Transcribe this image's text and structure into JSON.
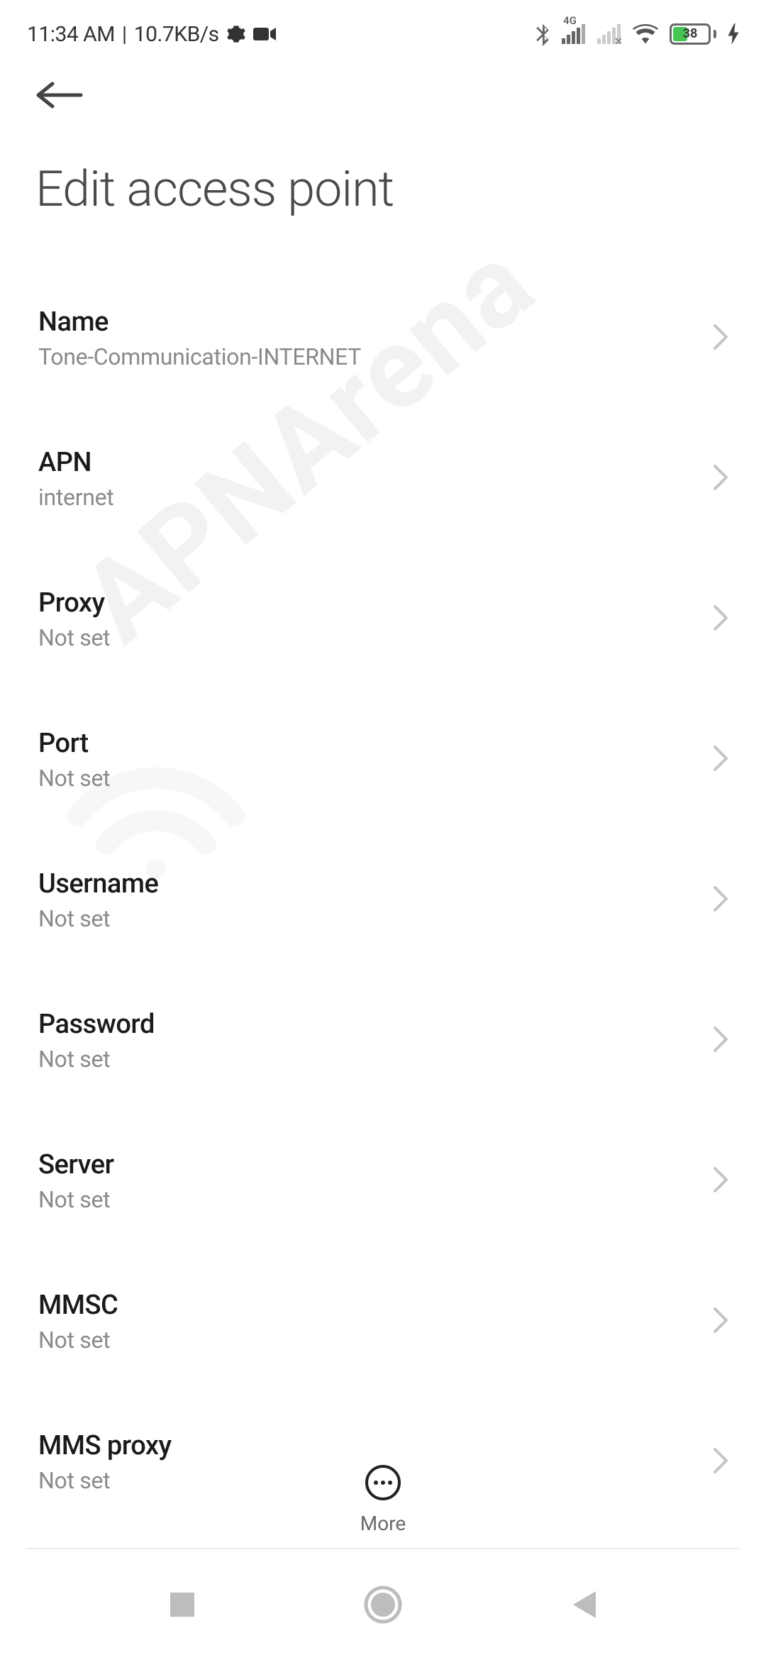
{
  "status": {
    "time": "11:34 AM",
    "net_speed": "10.7KB/s",
    "network_type": "4G",
    "battery_pct": "38"
  },
  "page": {
    "title": "Edit access point"
  },
  "fields": [
    {
      "label": "Name",
      "value": "Tone-Communication-INTERNET"
    },
    {
      "label": "APN",
      "value": "internet"
    },
    {
      "label": "Proxy",
      "value": "Not set"
    },
    {
      "label": "Port",
      "value": "Not set"
    },
    {
      "label": "Username",
      "value": "Not set"
    },
    {
      "label": "Password",
      "value": "Not set"
    },
    {
      "label": "Server",
      "value": "Not set"
    },
    {
      "label": "MMSC",
      "value": "Not set"
    },
    {
      "label": "MMS proxy",
      "value": "Not set"
    }
  ],
  "actions": {
    "more": "More"
  },
  "watermark": "APNArena"
}
